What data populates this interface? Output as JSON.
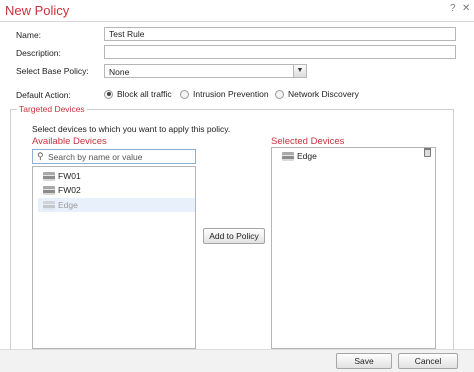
{
  "dialog": {
    "title": "New Policy",
    "help_glyph": "?",
    "close_glyph": "✕"
  },
  "form": {
    "name_label": "Name:",
    "name_value": "Test Rule",
    "description_label": "Description:",
    "description_value": "",
    "base_policy_label": "Select Base Policy:",
    "base_policy_value": "None",
    "default_action_label": "Default Action:",
    "default_actions": [
      {
        "label": "Block all traffic",
        "selected": true
      },
      {
        "label": "Intrusion Prevention",
        "selected": false
      },
      {
        "label": "Network Discovery",
        "selected": false
      }
    ]
  },
  "targeted_devices": {
    "title": "Targeted Devices",
    "hint": "Select devices to which you want to apply this policy.",
    "available_title": "Available Devices",
    "search_placeholder": "Search by name or value",
    "available": [
      {
        "name": "FW01",
        "disabled": false
      },
      {
        "name": "FW02",
        "disabled": false
      },
      {
        "name": "Edge",
        "disabled": true
      }
    ],
    "add_button": "Add to Policy",
    "selected_title": "Selected Devices",
    "selected": [
      {
        "name": "Edge"
      }
    ]
  },
  "footer": {
    "save": "Save",
    "cancel": "Cancel"
  },
  "colors": {
    "accent": "#c8323c",
    "selection": "#e8f0fb",
    "search_border": "#8faed3"
  },
  "icons": [
    "help-icon",
    "close-icon",
    "chevron-down-icon",
    "search-icon",
    "device-icon",
    "trash-icon"
  ]
}
